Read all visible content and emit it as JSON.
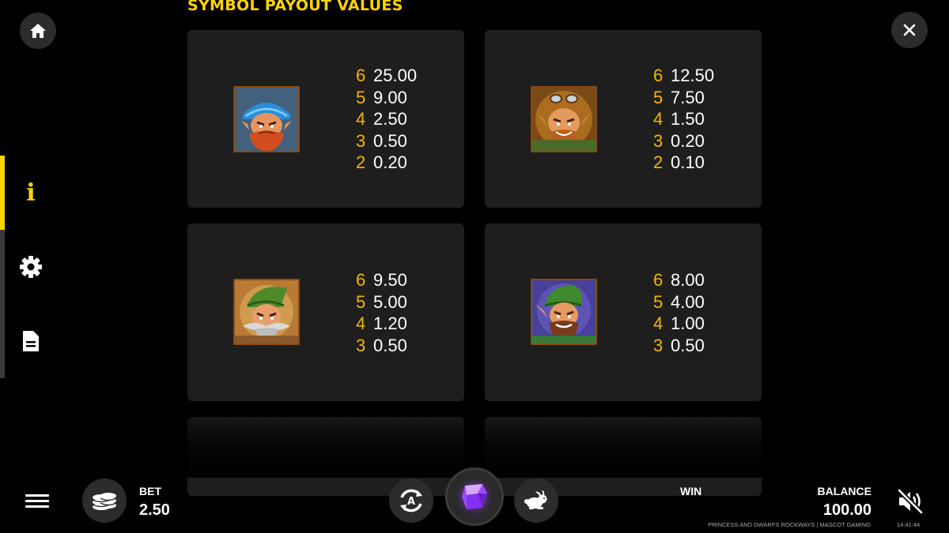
{
  "header": {
    "title": "SYMBOL PAYOUT VALUES"
  },
  "nav": {
    "home_icon": "home-icon",
    "close_icon": "close-icon"
  },
  "sidebar": {
    "active": "info",
    "items": [
      {
        "id": "info",
        "icon": "info-icon",
        "glyph": "i"
      },
      {
        "id": "settings",
        "icon": "gear-icon"
      },
      {
        "id": "rules",
        "icon": "document-icon"
      }
    ]
  },
  "paytable": [
    {
      "symbol": "dwarf-blue-hat",
      "pays": [
        {
          "count": "6",
          "value": "25.00"
        },
        {
          "count": "5",
          "value": "9.00"
        },
        {
          "count": "4",
          "value": "2.50"
        },
        {
          "count": "3",
          "value": "0.50"
        },
        {
          "count": "2",
          "value": "0.20"
        }
      ]
    },
    {
      "symbol": "dwarf-goggles",
      "pays": [
        {
          "count": "6",
          "value": "12.50"
        },
        {
          "count": "5",
          "value": "7.50"
        },
        {
          "count": "4",
          "value": "1.50"
        },
        {
          "count": "3",
          "value": "0.20"
        },
        {
          "count": "2",
          "value": "0.10"
        }
      ]
    },
    {
      "symbol": "dwarf-grey-beard",
      "pays": [
        {
          "count": "6",
          "value": "9.50"
        },
        {
          "count": "5",
          "value": "5.00"
        },
        {
          "count": "4",
          "value": "1.20"
        },
        {
          "count": "3",
          "value": "0.50"
        }
      ]
    },
    {
      "symbol": "dwarf-brown-beard",
      "pays": [
        {
          "count": "6",
          "value": "8.00"
        },
        {
          "count": "5",
          "value": "4.00"
        },
        {
          "count": "4",
          "value": "1.00"
        },
        {
          "count": "3",
          "value": "0.50"
        }
      ]
    }
  ],
  "bottom_bar": {
    "bet_label": "BET",
    "bet_value": "2.50",
    "win_label": "WIN",
    "balance_label": "BALANCE",
    "balance_value": "100.00",
    "game_credit": "PRINCESS AND DWARFS ROCKWAYS | MASCOT GAMING",
    "clock": "14:41:44",
    "sound_state": "muted"
  },
  "colors": {
    "accent": "#ffd400",
    "pay_count": "#f5b400",
    "card_bg": "#1e1e1e",
    "button_bg": "#2c2c2c",
    "spin_gem": "#8a3cf0"
  }
}
